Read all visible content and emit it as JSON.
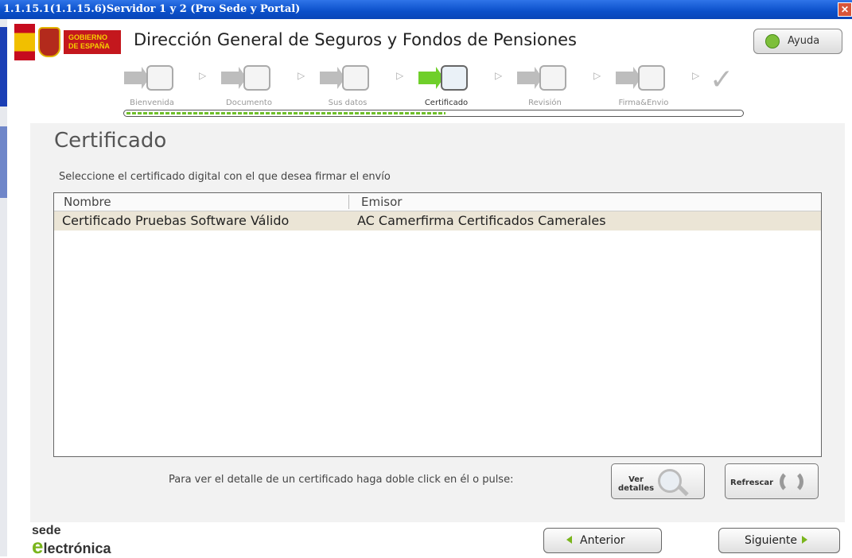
{
  "window": {
    "title": "1.1.15.1(1.1.15.6)Servidor 1 y 2 (Pro Sede y Portal)",
    "close_glyph": "✕"
  },
  "header": {
    "logo_text_line1": "GOBIERNO",
    "logo_text_line2": "DE ESPAÑA",
    "app_title": "Dirección General de Seguros y Fondos de Pensiones",
    "help_label": "Ayuda"
  },
  "wizard": {
    "steps": [
      {
        "label": "Bienvenida",
        "icon": "home-icon"
      },
      {
        "label": "Documento",
        "icon": "document-tree-icon"
      },
      {
        "label": "Sus datos",
        "icon": "form-icon"
      },
      {
        "label": "Certificado",
        "icon": "certificate-icon",
        "active": true
      },
      {
        "label": "Revisión",
        "icon": "magnifier-icon"
      },
      {
        "label": "Firma&Envio",
        "icon": "globe-icon"
      }
    ],
    "final_icon": "checkmark-icon",
    "progress_fraction": 0.52,
    "separator": "▷"
  },
  "main": {
    "title": "Certificado",
    "instruction": "Seleccione el certificado digital con el que desea firmar el envío",
    "table": {
      "columns": [
        "Nombre",
        "Emisor"
      ],
      "rows": [
        [
          "Certificado Pruebas Software Válido",
          "AC Camerfirma Certificados Camerales"
        ]
      ]
    },
    "detail_hint": "Para ver el detalle de un certificado haga doble click en él o pulse:",
    "view_details_line1": "Ver",
    "view_details_line2": "detalles",
    "refresh_label": "Refrescar"
  },
  "footer": {
    "sede_line1": "sede",
    "sede_line2_initial": "e",
    "sede_line2_rest": "lectrónica",
    "prev_label": "Anterior",
    "next_label": "Siguiente"
  },
  "colors": {
    "accent_green": "#7ab51d",
    "titlebar_blue": "#0a4fc9",
    "selected_row": "#ebe5d6"
  }
}
